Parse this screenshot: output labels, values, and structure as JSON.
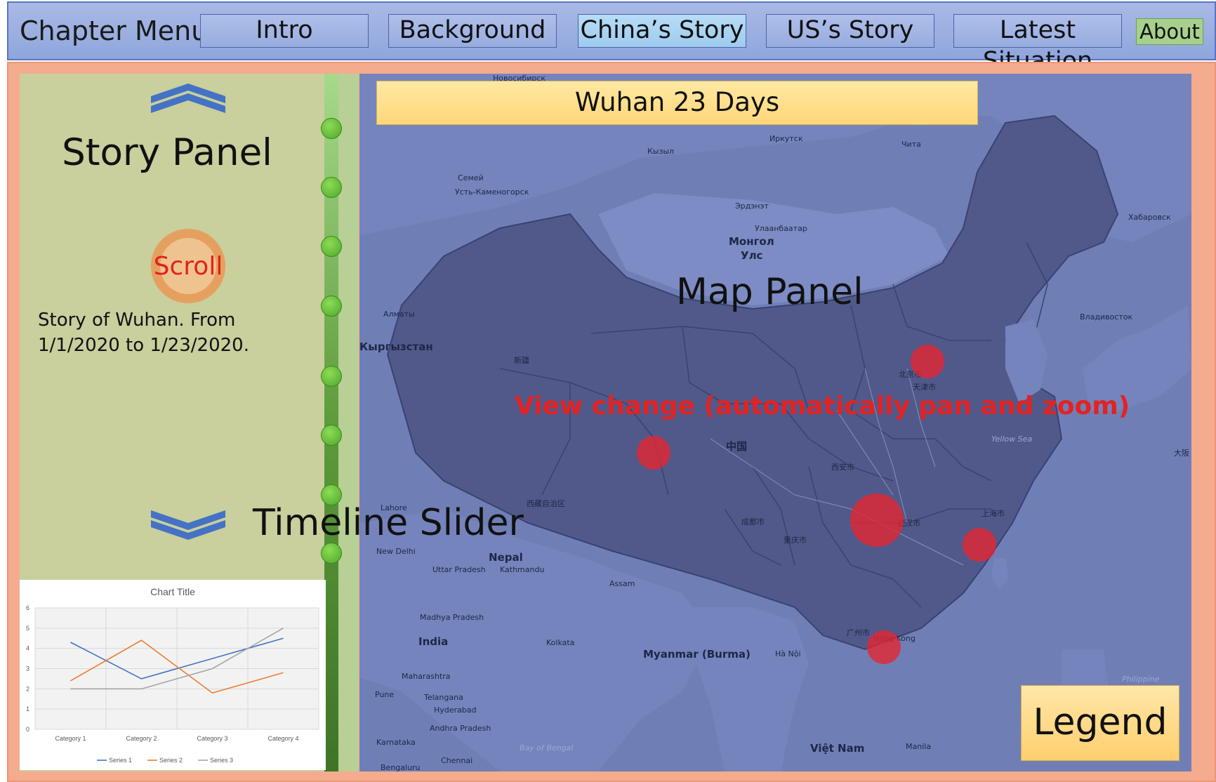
{
  "topbar": {
    "menu_title": "Chapter Menu",
    "tabs": [
      {
        "label": "Intro"
      },
      {
        "label": "Background"
      },
      {
        "label": "China’s Story"
      },
      {
        "label": "US’s Story"
      },
      {
        "label": "Latest Situation"
      }
    ],
    "about_label": "About"
  },
  "story": {
    "title": "Story Panel",
    "scroll_label": "Scroll",
    "text": "Story of Wuhan. From 1/1/2020 to 1/23/2020."
  },
  "timeline": {
    "label": "Timeline Slider",
    "node_count": 8
  },
  "map": {
    "title": "Wuhan 23 Days",
    "panel_label": "Map Panel",
    "view_change_label": "View change (automatically pan and zoom)",
    "legend_label": "Legend",
    "place_labels": {
      "novosibirsk": "Новосибирск",
      "kyzyl": "Кызыл",
      "irkutsk": "Иркутск",
      "chita": "Чита",
      "semey": "Семей",
      "ust_kamenogorsk": "Усть-Каменогорск",
      "erdenet": "Эрдэнэт",
      "ulaanbaatar": "Улаанбаатар",
      "mongol": "Монгол",
      "uls": "Улс",
      "khabarovsk": "Хабаровск",
      "vladivostok": "Владивосток",
      "almaty": "Алматы",
      "kyrgyzstan": "Кыргызстан",
      "lahore": "Lahore",
      "new_delhi": "New Delhi",
      "nepal": "Nepal",
      "kathmandu": "Kathmandu",
      "uttar_pradesh": "Uttar Pradesh",
      "assam": "Assam",
      "india": "India",
      "madhya_pradesh": "Madhya Pradesh",
      "kolkata": "Kolkata",
      "myanmar": "Myanmar (Burma)",
      "ha_noi": "Hà Nội",
      "maharashtra": "Maharashtra",
      "pune": "Pune",
      "telangana": "Telangana",
      "hyderabad": "Hyderabad",
      "andhra_pradesh": "Andhra Pradesh",
      "karnataka": "Karnataka",
      "chennai": "Chennai",
      "bengaluru": "Bengaluru",
      "bay_of_bengal": "Bay of Bengal",
      "viet_nam": "Việt Nam",
      "manila": "Manila",
      "philippines": "Philippine",
      "yellow_sea": "Yellow Sea",
      "hong_kong": "Hong Kong",
      "china": "中国",
      "xinjiang": "新疆",
      "tibet": "西藏自治区",
      "beijing": "北京市",
      "tianjin": "天津市",
      "shanghai": "上海市",
      "wuhan": "武汉市",
      "chengdu": "成都市",
      "chongqing": "重庆市",
      "xian": "西安市",
      "guangzhou": "广州市",
      "osaka": "大阪"
    }
  },
  "chart_data": {
    "type": "line",
    "title": "Chart Title",
    "categories": [
      "Category 1",
      "Category 2",
      "Category 3",
      "Category 4"
    ],
    "series": [
      {
        "name": "Series 1",
        "values": [
          4.3,
          2.5,
          3.5,
          4.5
        ],
        "color": "#4472c4"
      },
      {
        "name": "Series 2",
        "values": [
          2.4,
          4.4,
          1.8,
          2.8
        ],
        "color": "#ed7d31"
      },
      {
        "name": "Series 3",
        "values": [
          2,
          2,
          3,
          5
        ],
        "color": "#a5a5a5"
      }
    ],
    "ylim": [
      0,
      6
    ],
    "yticks": [
      0,
      1,
      2,
      3,
      4,
      5,
      6
    ],
    "grid": true,
    "legend_position": "bottom"
  },
  "colors": {
    "topbar": "#9fb2e3",
    "story_panel": "#c9cf9d",
    "frame": "#f4ab8e",
    "map_tint": "#6f7fb6",
    "hotspot": "#e82430",
    "timeline_node": "#5fbf37"
  },
  "icons": {
    "scroll_up": "chevron-up-double-icon",
    "scroll_down": "chevron-down-double-icon"
  }
}
